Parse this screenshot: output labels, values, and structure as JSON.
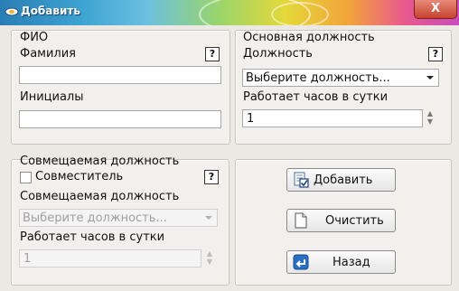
{
  "window": {
    "title": "Добавить",
    "close_label": "X"
  },
  "fio": {
    "group_title": "ФИО",
    "surname_label": "Фамилия",
    "surname_value": "",
    "initials_label": "Инициалы",
    "initials_value": "",
    "help": "?"
  },
  "main_position": {
    "group_title": "Основная должность",
    "position_label": "Должность",
    "position_selected": "Выберите должность...",
    "hours_label": "Работает часов в сутки",
    "hours_value": "1",
    "help": "?"
  },
  "combined_position": {
    "group_title": "Совмещаемая должность",
    "checkbox_label": "Совместитель",
    "checkbox_checked": false,
    "position_label": "Совмещаемая должность",
    "position_selected": "Выберите должность...",
    "hours_label": "Работает часов в сутки",
    "hours_value": "1",
    "help": "?"
  },
  "actions": {
    "add_label": "Добавить",
    "clear_label": "Очистить",
    "back_label": "Назад"
  },
  "spinner_glyphs": {
    "up": "▲",
    "down": "▼"
  },
  "colors": {
    "title_text": "#ffffff",
    "close_button": "#c7422f"
  }
}
